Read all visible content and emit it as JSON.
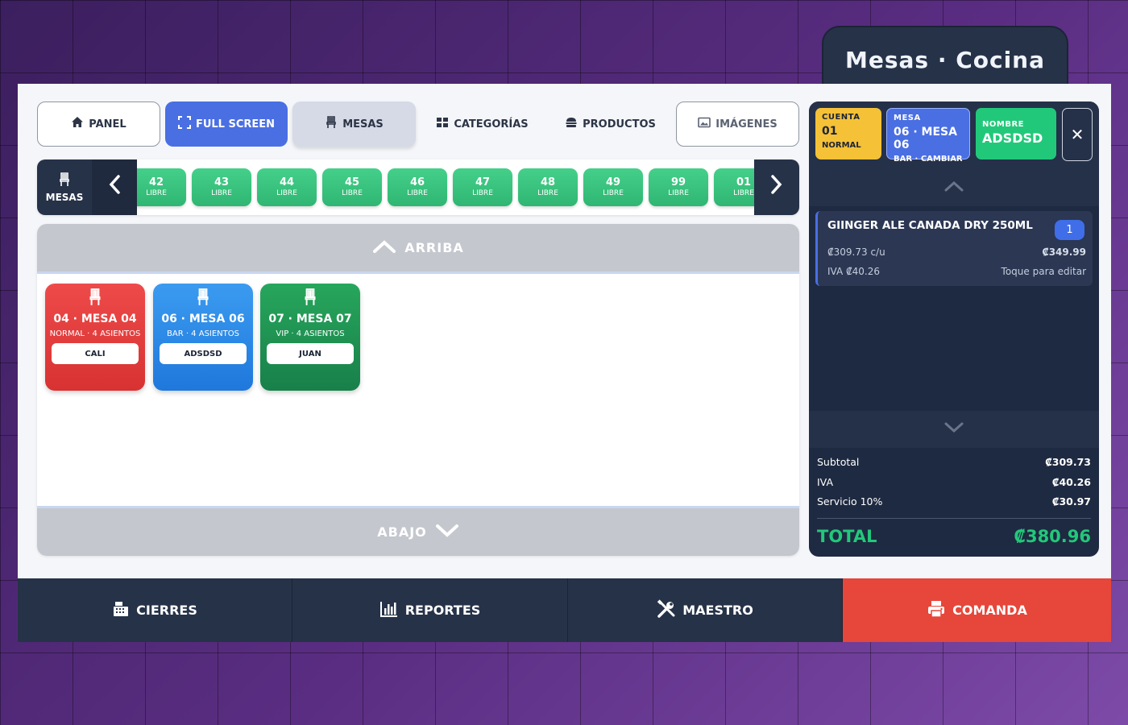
{
  "window": {
    "title": "Mesas · Cocina"
  },
  "nav": [
    {
      "label": "PANEL",
      "icon": "home-icon"
    },
    {
      "label": "FULL SCREEN",
      "icon": "expand-icon"
    },
    {
      "label": "MESAS",
      "icon": "chair-icon"
    },
    {
      "label": "CATEGORÍAS",
      "icon": "grid-icon"
    },
    {
      "label": "PRODUCTOS",
      "icon": "burger-icon"
    },
    {
      "label": "IMÁGENES",
      "icon": "image-icon"
    }
  ],
  "strip": {
    "label": "MESAS",
    "chips": [
      {
        "number": "42",
        "status": "LIBRE"
      },
      {
        "number": "43",
        "status": "LIBRE"
      },
      {
        "number": "44",
        "status": "LIBRE"
      },
      {
        "number": "45",
        "status": "LIBRE"
      },
      {
        "number": "46",
        "status": "LIBRE"
      },
      {
        "number": "47",
        "status": "LIBRE"
      },
      {
        "number": "48",
        "status": "LIBRE"
      },
      {
        "number": "49",
        "status": "LIBRE"
      },
      {
        "number": "99",
        "status": "LIBRE"
      },
      {
        "number": "01",
        "status": "LIBRE"
      }
    ]
  },
  "area": {
    "up_label": "ARRIBA",
    "down_label": "ABAJO",
    "tables": [
      {
        "title": "04 · MESA 04",
        "subtitle": "NORMAL · 4 ASIENTOS",
        "client": "CALI",
        "color": "#e53b3b"
      },
      {
        "title": "06 · MESA 06",
        "subtitle": "BAR · 4 ASIENTOS",
        "client": "ADSDSD",
        "color": "#2a88e6"
      },
      {
        "title": "07 · MESA 07",
        "subtitle": "VIP · 4 ASIENTOS",
        "client": "JUAN",
        "color": "#1f9152"
      }
    ]
  },
  "order": {
    "cuenta": {
      "label": "CUENTA",
      "value": "01",
      "extra": "NORMAL",
      "color": "#f5c136"
    },
    "mesa": {
      "label": "MESA",
      "value": "06 · MESA 06",
      "extra": "BAR · CAMBIAR",
      "color": "#4a6fe3"
    },
    "nombre": {
      "label": "NOMBRE",
      "value": "ADSDSD",
      "color": "#22c87a"
    },
    "close": "✕",
    "items": [
      {
        "name": "GIINGER ALE CANADA DRY 250ML",
        "qty": "1",
        "unit_price": "₡309.73 c/u",
        "total": "₡349.99",
        "iva": "IVA ₡40.26",
        "edit_hint": "Toque para editar"
      }
    ],
    "totals": {
      "subtotal_label": "Subtotal",
      "subtotal": "₡309.73",
      "iva_label": "IVA",
      "iva": "₡40.26",
      "service_label": "Servicio 10%",
      "service": "₡30.97",
      "total_label": "TOTAL",
      "total": "₡380.96"
    }
  },
  "bottom": [
    {
      "label": "CIERRES",
      "icon": "cash-register-icon"
    },
    {
      "label": "REPORTES",
      "icon": "chart-icon"
    },
    {
      "label": "MAESTRO",
      "icon": "tools-icon"
    },
    {
      "label": "COMANDA",
      "icon": "printer-icon",
      "color": "#e7463a"
    }
  ]
}
